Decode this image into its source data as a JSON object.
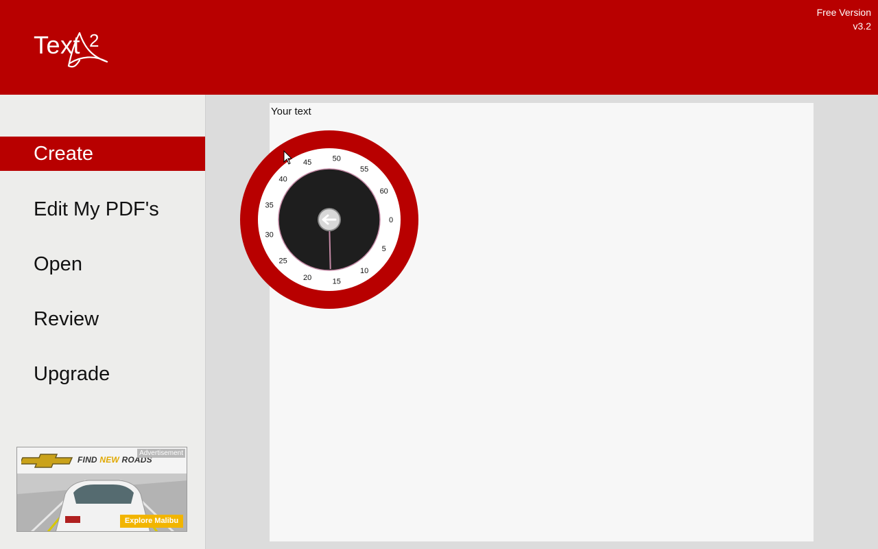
{
  "header": {
    "logo_text": "Text",
    "logo_superscript": "2",
    "edition": "Free Version",
    "version": "v3.2",
    "brand_color": "#b80000"
  },
  "sidebar": {
    "items": [
      {
        "label": "Create",
        "active": true
      },
      {
        "label": "Edit My PDF's",
        "active": false
      },
      {
        "label": "Open",
        "active": false
      },
      {
        "label": "Review",
        "active": false
      },
      {
        "label": "Upgrade",
        "active": false
      }
    ]
  },
  "ad": {
    "label": "Advertisement",
    "tagline_pre": "FIND ",
    "tagline_highlight": "NEW",
    "tagline_post": " ROADS",
    "cta": "Explore Malibu"
  },
  "canvas": {
    "text": "Your text"
  },
  "dial": {
    "tick_labels": [
      "0",
      "5",
      "10",
      "15",
      "20",
      "25",
      "30",
      "35",
      "40",
      "45",
      "50",
      "55",
      "60"
    ],
    "selected_value": 16,
    "back_icon": "arrow-left-icon",
    "ring_color": "#b80000",
    "face_color": "#1e1e1e",
    "hand_color": "#c58aa6"
  }
}
